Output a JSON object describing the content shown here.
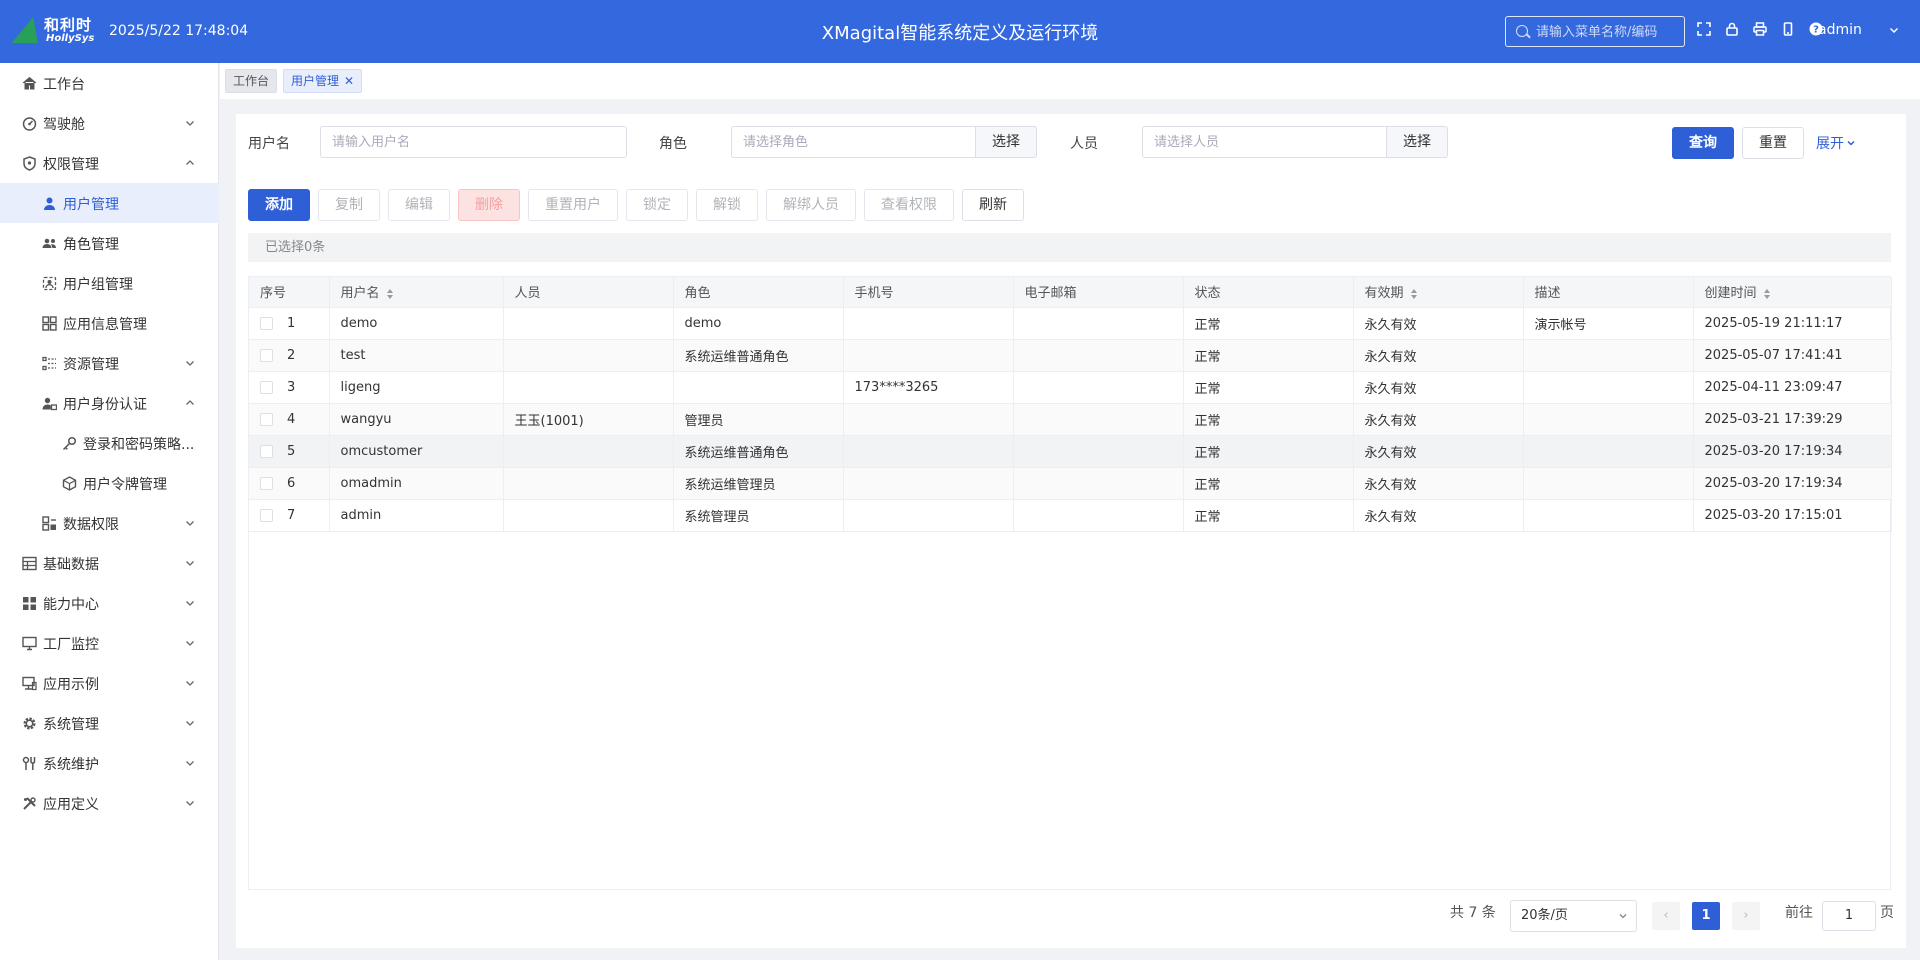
{
  "header": {
    "logo_cn": "和利时",
    "logo_en": "HollySys",
    "datetime": "2025/5/22 17:48:04",
    "title": "XMagital智能系统定义及运行环境",
    "search_placeholder": "请输入菜单名称/编码",
    "user": "admin",
    "bg_color": "#3368de"
  },
  "sidebar": {
    "items": [
      {
        "label": "工作台",
        "icon": "home-icon"
      },
      {
        "label": "驾驶舱",
        "icon": "dashboard-icon",
        "arrow": "down"
      },
      {
        "label": "权限管理",
        "icon": "shield-icon",
        "arrow": "up"
      },
      {
        "label": "用户管理",
        "icon": "user-icon",
        "active": true
      },
      {
        "label": "角色管理",
        "icon": "users-icon"
      },
      {
        "label": "用户组管理",
        "icon": "user-group-icon"
      },
      {
        "label": "应用信息管理",
        "icon": "apps-icon"
      },
      {
        "label": "资源管理",
        "icon": "resource-icon",
        "arrow": "down"
      },
      {
        "label": "用户身份认证",
        "icon": "user-auth-icon",
        "arrow": "up"
      },
      {
        "label": "登录和密码策略...",
        "icon": "key-icon"
      },
      {
        "label": "用户令牌管理",
        "icon": "token-icon"
      },
      {
        "label": "数据权限",
        "icon": "data-permission-icon",
        "arrow": "down"
      },
      {
        "label": "基础数据",
        "icon": "table-icon",
        "arrow": "down"
      },
      {
        "label": "能力中心",
        "icon": "grid-icon",
        "arrow": "down"
      },
      {
        "label": "工厂监控",
        "icon": "monitor-icon",
        "arrow": "down"
      },
      {
        "label": "应用示例",
        "icon": "example-icon",
        "arrow": "down"
      },
      {
        "label": "系统管理",
        "icon": "gear-icon",
        "arrow": "down"
      },
      {
        "label": "系统维护",
        "icon": "wrench-icon",
        "arrow": "down"
      },
      {
        "label": "应用定义",
        "icon": "tools-icon",
        "arrow": "down"
      }
    ]
  },
  "tabs": {
    "home": "工作台",
    "current": "用户管理"
  },
  "filters": {
    "username_label": "用户名",
    "username_placeholder": "请输入用户名",
    "role_label": "角色",
    "role_placeholder": "请选择角色",
    "role_select": "选择",
    "person_label": "人员",
    "person_placeholder": "请选择人员",
    "person_select": "选择",
    "query": "查询",
    "reset": "重置",
    "expand": "展开"
  },
  "toolbar": {
    "add": "添加",
    "copy": "复制",
    "edit": "编辑",
    "delete": "删除",
    "reset_user": "重置用户",
    "lock": "锁定",
    "unlock": "解锁",
    "unbind": "解绑人员",
    "view_perm": "查看权限",
    "refresh": "刷新"
  },
  "selection_text": "已选择0条",
  "table": {
    "columns": [
      "序号",
      "用户名",
      "人员",
      "角色",
      "手机号",
      "电子邮箱",
      "状态",
      "有效期",
      "描述",
      "创建时间"
    ],
    "rows": [
      {
        "no": "1",
        "username": "demo",
        "person": "",
        "role": "demo",
        "phone": "",
        "email": "",
        "status": "正常",
        "validity": "永久有效",
        "desc": "演示帐号",
        "created": "2025-05-19 21:11:17"
      },
      {
        "no": "2",
        "username": "test",
        "person": "",
        "role": "系统运维普通角色",
        "phone": "",
        "email": "",
        "status": "正常",
        "validity": "永久有效",
        "desc": "",
        "created": "2025-05-07 17:41:41"
      },
      {
        "no": "3",
        "username": "ligeng",
        "person": "",
        "role": "",
        "phone": "173****3265",
        "email": "",
        "status": "正常",
        "validity": "永久有效",
        "desc": "",
        "created": "2025-04-11 23:09:47"
      },
      {
        "no": "4",
        "username": "wangyu",
        "person": "王玉(1001)",
        "role": "管理员",
        "phone": "",
        "email": "",
        "status": "正常",
        "validity": "永久有效",
        "desc": "",
        "created": "2025-03-21 17:39:29"
      },
      {
        "no": "5",
        "username": "omcustomer",
        "person": "",
        "role": "系统运维普通角色",
        "phone": "",
        "email": "",
        "status": "正常",
        "validity": "永久有效",
        "desc": "",
        "created": "2025-03-20 17:19:34"
      },
      {
        "no": "6",
        "username": "omadmin",
        "person": "",
        "role": "系统运维管理员",
        "phone": "",
        "email": "",
        "status": "正常",
        "validity": "永久有效",
        "desc": "",
        "created": "2025-03-20 17:19:34"
      },
      {
        "no": "7",
        "username": "admin",
        "person": "",
        "role": "系统管理员",
        "phone": "",
        "email": "",
        "status": "正常",
        "validity": "永久有效",
        "desc": "",
        "created": "2025-03-20 17:15:01"
      }
    ]
  },
  "pagination": {
    "total": "共 7 条",
    "page_size": "20条/页",
    "current_page": "1",
    "goto_label": "前往",
    "goto_value": "1",
    "page_suffix": "页",
    "prev": "‹",
    "next": "›"
  },
  "colors": {
    "primary": "#2f5fd7",
    "header": "#3368de"
  }
}
